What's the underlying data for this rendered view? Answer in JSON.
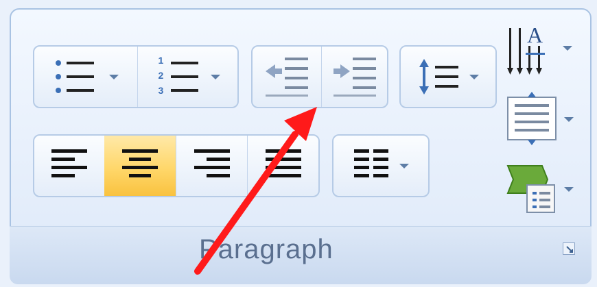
{
  "group_label": "Paragraph",
  "colors": {
    "annotation_arrow": "#ff1a1a",
    "active_highlight": "#ffd76a"
  },
  "buttons": [
    {
      "icon": "bullets-icon",
      "has_dropdown": true
    },
    {
      "icon": "numbering-icon",
      "has_dropdown": true,
      "numbers": [
        "1",
        "2",
        "3"
      ]
    },
    {
      "icon": "decrease-indent-icon"
    },
    {
      "icon": "increase-indent-icon"
    },
    {
      "icon": "line-spacing-icon",
      "has_dropdown": true
    },
    {
      "icon": "sort-icon",
      "letter": "A",
      "has_dropdown": true
    },
    {
      "icon": "shading-icon",
      "has_dropdown": true
    },
    {
      "icon": "borders-icon",
      "has_dropdown": true
    },
    {
      "icon": "align-left-icon"
    },
    {
      "icon": "align-center-icon",
      "active": true
    },
    {
      "icon": "align-right-icon"
    },
    {
      "icon": "justify-icon"
    },
    {
      "icon": "columns-icon",
      "has_dropdown": true
    }
  ]
}
